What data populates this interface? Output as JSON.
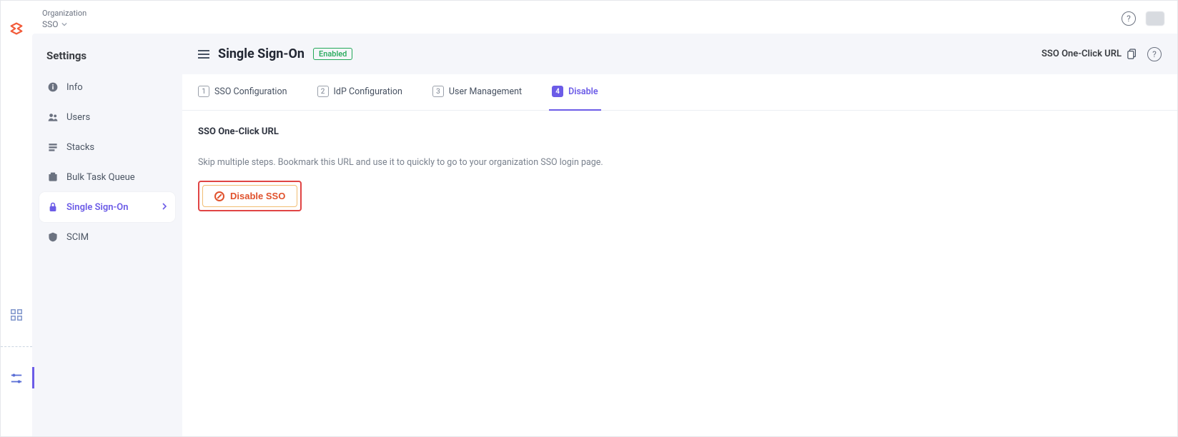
{
  "breadcrumb": {
    "org_label": "Organization",
    "current": "SSO"
  },
  "sidebar": {
    "title": "Settings",
    "items": [
      {
        "label": "Info"
      },
      {
        "label": "Users"
      },
      {
        "label": "Stacks"
      },
      {
        "label": "Bulk Task Queue"
      },
      {
        "label": "Single Sign-On"
      },
      {
        "label": "SCIM"
      }
    ]
  },
  "header": {
    "title": "Single Sign-On",
    "badge": "Enabled",
    "one_click_label": "SSO One-Click URL"
  },
  "steps": [
    {
      "num": "1",
      "label": "SSO Configuration"
    },
    {
      "num": "2",
      "label": "IdP Configuration"
    },
    {
      "num": "3",
      "label": "User Management"
    },
    {
      "num": "4",
      "label": "Disable"
    }
  ],
  "pane": {
    "section_title": "SSO One-Click URL",
    "description": "Skip multiple steps. Bookmark this URL and use it to quickly to go to your organization SSO login page.",
    "disable_button": "Disable SSO"
  }
}
